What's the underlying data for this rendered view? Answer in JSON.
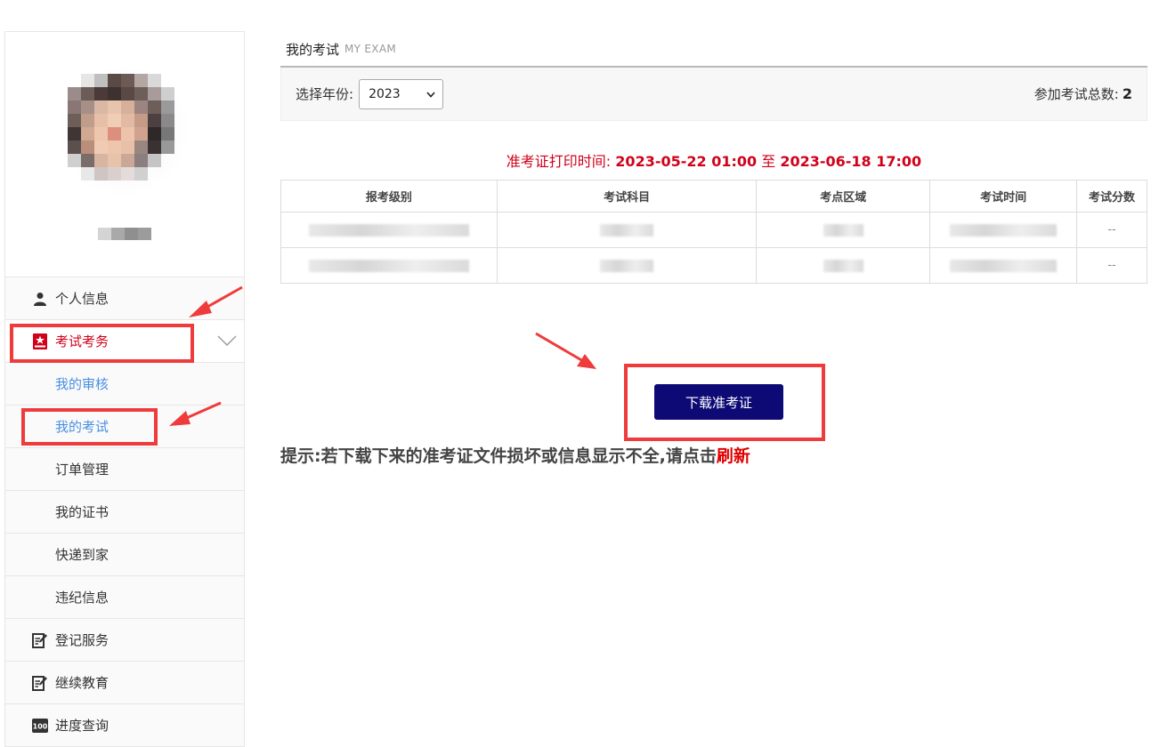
{
  "sidebar": {
    "menu": [
      {
        "label": "个人信息",
        "icon": "user-icon"
      },
      {
        "label": "考试考务",
        "icon": "exam-badge-icon",
        "active": true
      },
      {
        "label": "登记服务",
        "icon": "edit-icon"
      },
      {
        "label": "继续教育",
        "icon": "edit-icon"
      },
      {
        "label": "进度查询",
        "icon": "progress-100-icon"
      }
    ],
    "submenu": [
      "我的审核",
      "我的考试",
      "订单管理",
      "我的证书",
      "快递到家",
      "违纪信息"
    ]
  },
  "main": {
    "title": "我的考试",
    "title_en": "MY EXAM",
    "year_label": "选择年份:",
    "year_value": "2023",
    "total_label": "参加考试总数:",
    "total_value": "2",
    "print_time_label": "准考证打印时间:",
    "print_time_start": "2023-05-22 01:00",
    "print_time_sep": "至",
    "print_time_end": "2023-06-18 17:00",
    "table": {
      "headers": [
        "报考级别",
        "考试科目",
        "考点区域",
        "考试时间",
        "考试分数"
      ],
      "rows": [
        {
          "score": "--"
        },
        {
          "score": "--"
        }
      ]
    },
    "download_label": "下载准考证",
    "tip_text": "提示:若下载下来的准考证文件损坏或信息显示不全,请点击",
    "tip_refresh": "刷新"
  },
  "colors": {
    "accent_red": "#d0021b",
    "button_navy": "#0d0a75",
    "annotation_red": "#ef3b3b",
    "link_blue": "#4a90e2"
  }
}
